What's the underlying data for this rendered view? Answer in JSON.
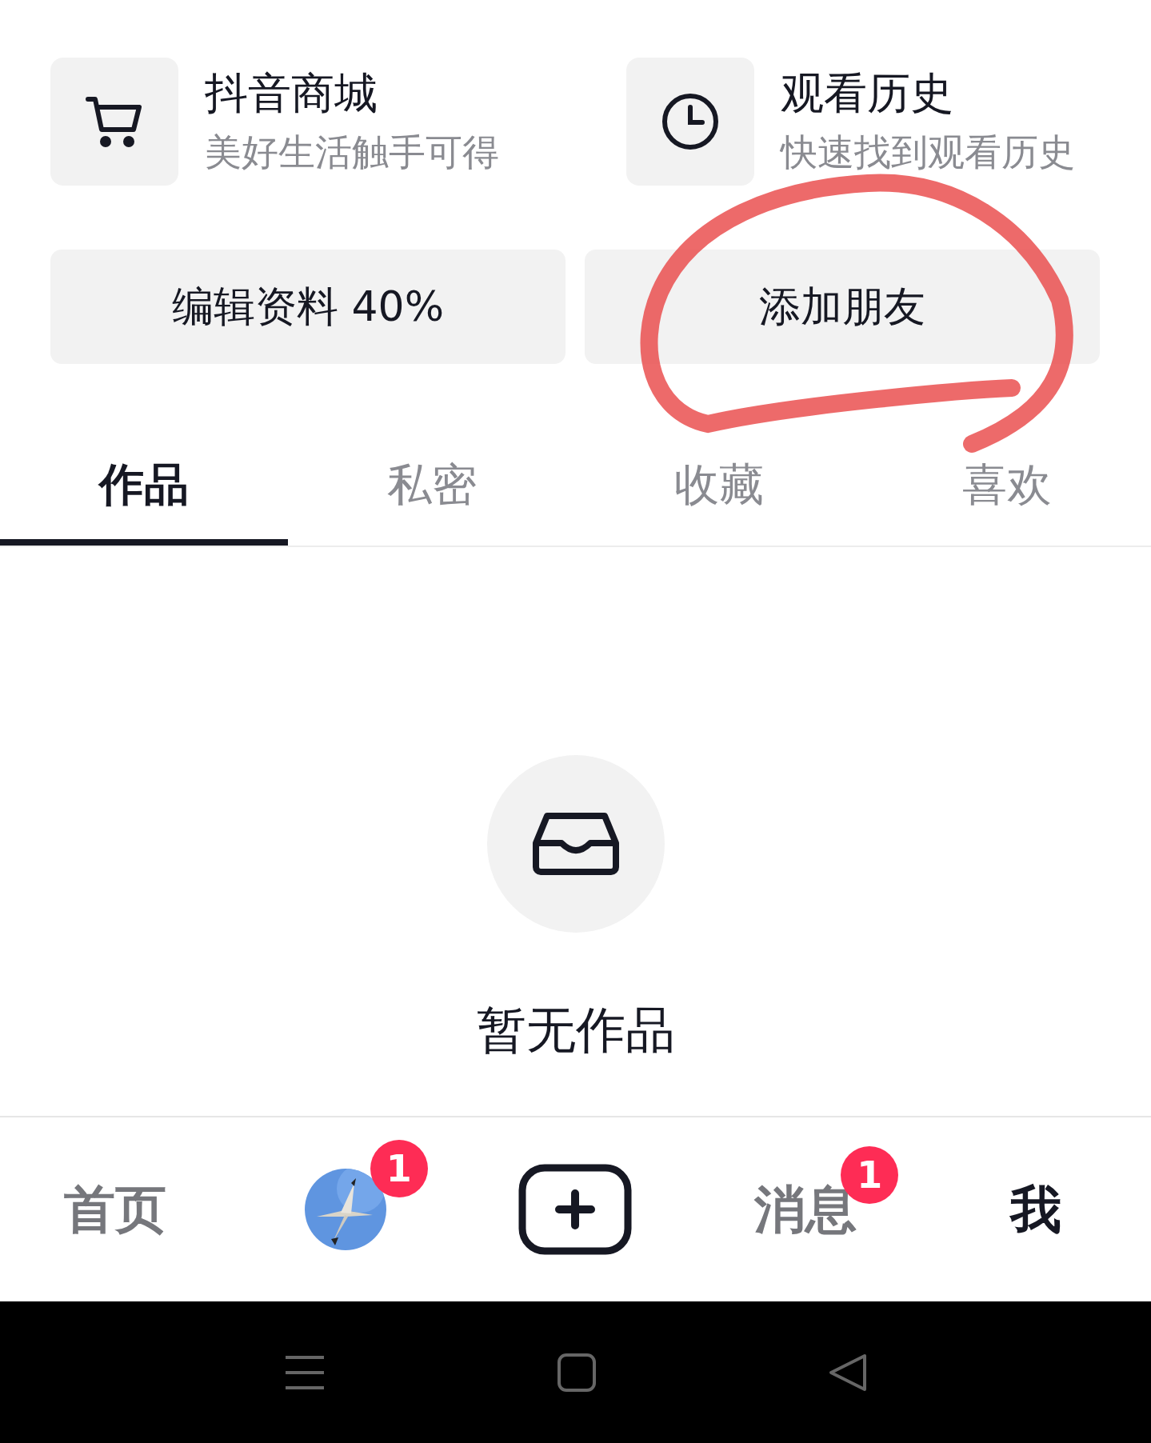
{
  "shortcuts": [
    {
      "kind": "cart",
      "title": "抖音商城",
      "subtitle": "美好生活触手可得"
    },
    {
      "kind": "clock",
      "title": "观看历史",
      "subtitle": "快速找到观看历史"
    }
  ],
  "actions": [
    "编辑资料 40%",
    "添加朋友"
  ],
  "annotation": {
    "kind": "circle"
  },
  "tabs": [
    {
      "label": "作品",
      "selected": true
    },
    {
      "label": "私密",
      "selected": false
    },
    {
      "label": "收藏",
      "selected": false
    },
    {
      "label": "喜欢",
      "selected": false
    }
  ],
  "empty_state": {
    "title": "暂无作品"
  },
  "bottom_nav": [
    {
      "kind": "text",
      "label": "首页",
      "selected": false
    },
    {
      "kind": "avatar",
      "badge": "1"
    },
    {
      "kind": "create"
    },
    {
      "kind": "text",
      "label": "消息",
      "selected": false,
      "badge": "1"
    },
    {
      "kind": "text",
      "label": "我",
      "selected": true
    }
  ]
}
